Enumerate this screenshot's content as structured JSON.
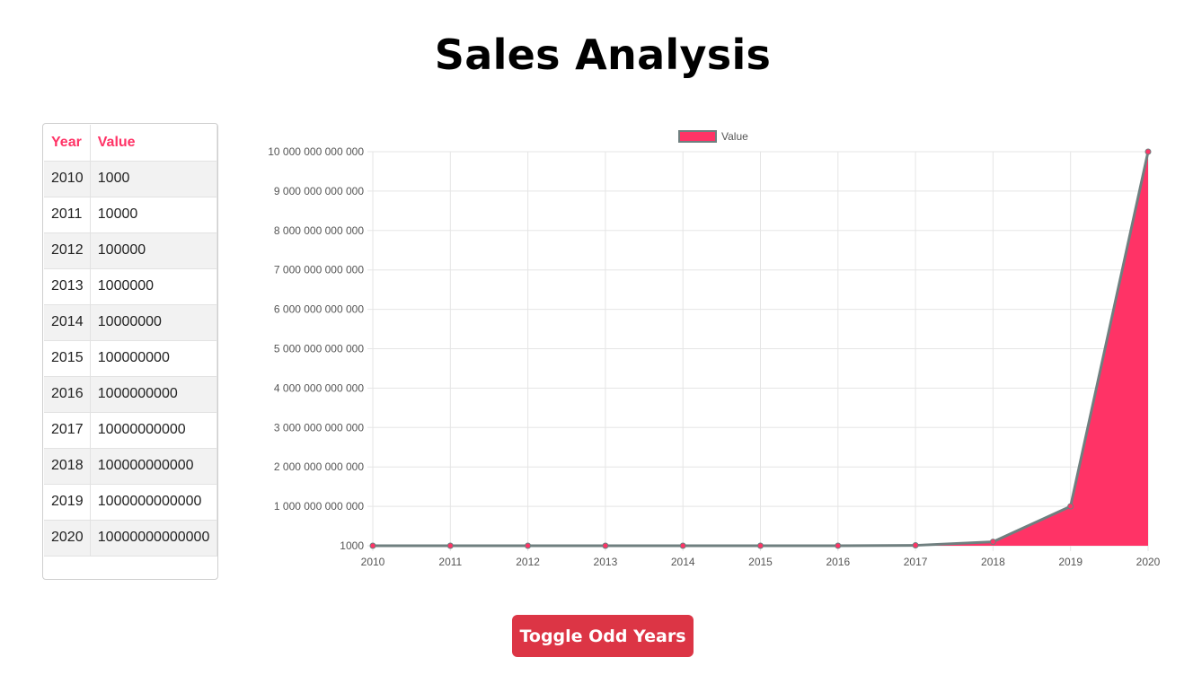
{
  "page": {
    "title": "Sales Analysis"
  },
  "table": {
    "headers": {
      "year": "Year",
      "value": "Value"
    },
    "rows": [
      {
        "year": "2010",
        "value": "1000"
      },
      {
        "year": "2011",
        "value": "10000"
      },
      {
        "year": "2012",
        "value": "100000"
      },
      {
        "year": "2013",
        "value": "1000000"
      },
      {
        "year": "2014",
        "value": "10000000"
      },
      {
        "year": "2015",
        "value": "100000000"
      },
      {
        "year": "2016",
        "value": "1000000000"
      },
      {
        "year": "2017",
        "value": "10000000000"
      },
      {
        "year": "2018",
        "value": "100000000000"
      },
      {
        "year": "2019",
        "value": "1000000000000"
      },
      {
        "year": "2020",
        "value": "10000000000000"
      }
    ]
  },
  "controls": {
    "toggle_label": "Toggle Odd Years"
  },
  "colors": {
    "accent": "#ff3366",
    "series_fill": "#ff3366",
    "series_line": "#6f7f7f",
    "button": "#dc3545",
    "grid": "#e5e5e5",
    "tick_text": "#555555"
  },
  "chart_data": {
    "type": "area",
    "categories": [
      "2010",
      "2011",
      "2012",
      "2013",
      "2014",
      "2015",
      "2016",
      "2017",
      "2018",
      "2019",
      "2020"
    ],
    "series": [
      {
        "name": "Value",
        "values": [
          1000,
          10000,
          100000,
          1000000,
          10000000,
          100000000,
          1000000000,
          10000000000,
          100000000000,
          1000000000000,
          10000000000000
        ]
      }
    ],
    "y_ticks": [
      {
        "value": 1000,
        "label": "1000"
      },
      {
        "value": 1000000000000,
        "label": "1 000 000 000 000"
      },
      {
        "value": 2000000000000,
        "label": "2 000 000 000 000"
      },
      {
        "value": 3000000000000,
        "label": "3 000 000 000 000"
      },
      {
        "value": 4000000000000,
        "label": "4 000 000 000 000"
      },
      {
        "value": 5000000000000,
        "label": "5 000 000 000 000"
      },
      {
        "value": 6000000000000,
        "label": "6 000 000 000 000"
      },
      {
        "value": 7000000000000,
        "label": "7 000 000 000 000"
      },
      {
        "value": 8000000000000,
        "label": "8 000 000 000 000"
      },
      {
        "value": 9000000000000,
        "label": "9 000 000 000 000"
      },
      {
        "value": 10000000000000,
        "label": "10 000 000 000 000"
      }
    ],
    "ylim": [
      1000,
      10000000000000
    ],
    "grid": true,
    "legend_position": "top-center"
  }
}
